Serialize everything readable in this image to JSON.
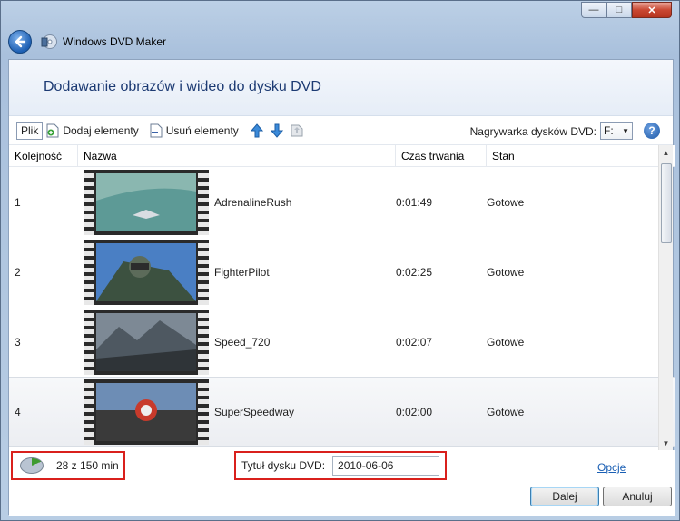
{
  "window": {
    "title": "Windows DVD Maker"
  },
  "page": {
    "heading": "Dodawanie obrazów i wideo do dysku DVD"
  },
  "toolbar": {
    "file_menu": "Plik",
    "add_items": "Dodaj elementy",
    "remove_items": "Usuń elementy",
    "burner_label": "Nagrywarka dysków DVD:",
    "burner_value": "F:",
    "help": "?"
  },
  "columns": {
    "order": "Kolejność",
    "name": "Nazwa",
    "duration": "Czas trwania",
    "state": "Stan"
  },
  "items": [
    {
      "order": "1",
      "name": "AdrenalineRush",
      "duration": "0:01:49",
      "state": "Gotowe",
      "selected": false
    },
    {
      "order": "2",
      "name": "FighterPilot",
      "duration": "0:02:25",
      "state": "Gotowe",
      "selected": false
    },
    {
      "order": "3",
      "name": "Speed_720",
      "duration": "0:02:07",
      "state": "Gotowe",
      "selected": false
    },
    {
      "order": "4",
      "name": "SuperSpeedway",
      "duration": "0:02:00",
      "state": "Gotowe",
      "selected": true
    }
  ],
  "footer": {
    "usage": "28 z 150 min",
    "usage_fraction": 0.187,
    "disc_title_label": "Tytuł dysku DVD:",
    "disc_title_value": "2010-06-06",
    "options_link": "Opcje",
    "next_button": "Dalej",
    "cancel_button": "Anuluj"
  },
  "colors": {
    "accent": "#1c3a73",
    "highlight_box": "#d9201c",
    "link": "#1a5fb4"
  }
}
